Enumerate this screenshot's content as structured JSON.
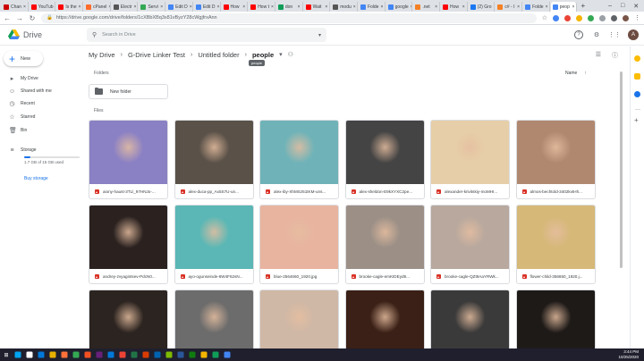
{
  "browser": {
    "tabs": [
      {
        "label": "Chan",
        "color": "#c00"
      },
      {
        "label": "YouTub",
        "color": "#f00"
      },
      {
        "label": "Is the",
        "color": "#f00"
      },
      {
        "label": "cPanel",
        "color": "#ff6c2c"
      },
      {
        "label": "Electr",
        "color": "#555"
      },
      {
        "label": "Servi",
        "color": "#34a853"
      },
      {
        "label": "Edit D",
        "color": "#4285f4"
      },
      {
        "label": "Edit D",
        "color": "#4285f4"
      },
      {
        "label": "How",
        "color": "#f00"
      },
      {
        "label": "How t",
        "color": "#f00"
      },
      {
        "label": "don",
        "color": "#0f9d58"
      },
      {
        "label": "Wait",
        "color": "#f00"
      },
      {
        "label": "modu",
        "color": "#555"
      },
      {
        "label": "Folde",
        "color": "#4285f4"
      },
      {
        "label": "google",
        "color": "#4285f4"
      },
      {
        "label": ".net",
        "color": "#f48024"
      },
      {
        "label": "How",
        "color": "#f00"
      },
      {
        "label": "(2) Gro",
        "color": "#1877f2"
      },
      {
        "label": "c# - I",
        "color": "#f48024"
      },
      {
        "label": "Folde",
        "color": "#4285f4"
      },
      {
        "label": "peop",
        "color": "#4285f4"
      }
    ],
    "new_tab": "+",
    "url": "https://drive.google.com/drive/folders/1cXBbXBq3x81vByzY28cWgjfrxAnn",
    "window_controls": [
      "–",
      "□",
      "✕"
    ]
  },
  "header": {
    "app_name": "Drive",
    "search_placeholder": "Search in Drive",
    "avatar_initial": "A"
  },
  "sidebar": {
    "new_label": "New",
    "items": [
      {
        "label": "My Drive",
        "icon": "drive-icon"
      },
      {
        "label": "Shared with me",
        "icon": "shared-icon"
      },
      {
        "label": "Recent",
        "icon": "clock-icon"
      },
      {
        "label": "Starred",
        "icon": "star-icon"
      },
      {
        "label": "Bin",
        "icon": "trash-icon"
      }
    ],
    "storage_label": "Storage",
    "storage_text": "1.7 GB of 15 GB used",
    "storage_fraction": 0.11,
    "buy_storage": "Buy storage"
  },
  "breadcrumb": {
    "items": [
      "My Drive",
      "G-Drive Linker Test",
      "Untitled folder",
      "people"
    ],
    "tooltip": "people"
  },
  "main": {
    "folders_label": "Folders",
    "sort_label": "Name",
    "sort_arrow": "↑",
    "folder_name": "New folder",
    "files_label": "Files",
    "files": [
      {
        "name": "aiony-haust-3TLl_97HNJo-...",
        "bg": "#8a80c4"
      },
      {
        "name": "alex-duca-pp_Ax5S7U-un...",
        "bg": "#5a5148"
      },
      {
        "name": "alex-iby-XhMSz51tKM-uns...",
        "bg": "#6fb3b8"
      },
      {
        "name": "alex-sheldon-E9kXYXC2pe...",
        "bg": "#444"
      },
      {
        "name": "alexander-krivitskiy-moMHI...",
        "bg": "#e6cfa8"
      },
      {
        "name": "almos-bechtold-3402kvtHh...",
        "bg": "#b08870"
      },
      {
        "name": "andrey-zvyagintsev-PdcN0...",
        "bg": "#2b2220"
      },
      {
        "name": "ayo-ogunseinde-6W4F62sN...",
        "bg": "#5ab7b5"
      },
      {
        "name": "blue-2564660_1920.jpg",
        "bg": "#e8b4a0"
      },
      {
        "name": "brooke-cagle-emKIDEyd9...",
        "bg": "#9b8f86"
      },
      {
        "name": "brooke-cagle-QZt9AaYRWk...",
        "bg": "#b8a89e"
      },
      {
        "name": "flower-child-356650_1920.j...",
        "bg": "#d6b878"
      },
      {
        "name": "",
        "bg": "#2c2420"
      },
      {
        "name": "",
        "bg": "#6c6c6c"
      },
      {
        "name": "",
        "bg": "#cfb8a6"
      },
      {
        "name": "",
        "bg": "#3a2016"
      },
      {
        "name": "",
        "bg": "#3a3a3a"
      },
      {
        "name": "",
        "bg": "#1e1a18"
      }
    ]
  },
  "taskbar": {
    "icons": [
      "#00a4ef",
      "#fff",
      "#0078d7",
      "#e8b000",
      "#ff7139",
      "#34a853",
      "#f25022",
      "#68217a",
      "#0078d7",
      "#ea4335",
      "#217346",
      "#d83b01",
      "#0063b1",
      "#7fba00",
      "#2b579a",
      "#107c10",
      "#f4b400",
      "#0f9d58",
      "#4285f4"
    ],
    "time": "3:44 PM",
    "date": "10/25/2020"
  }
}
